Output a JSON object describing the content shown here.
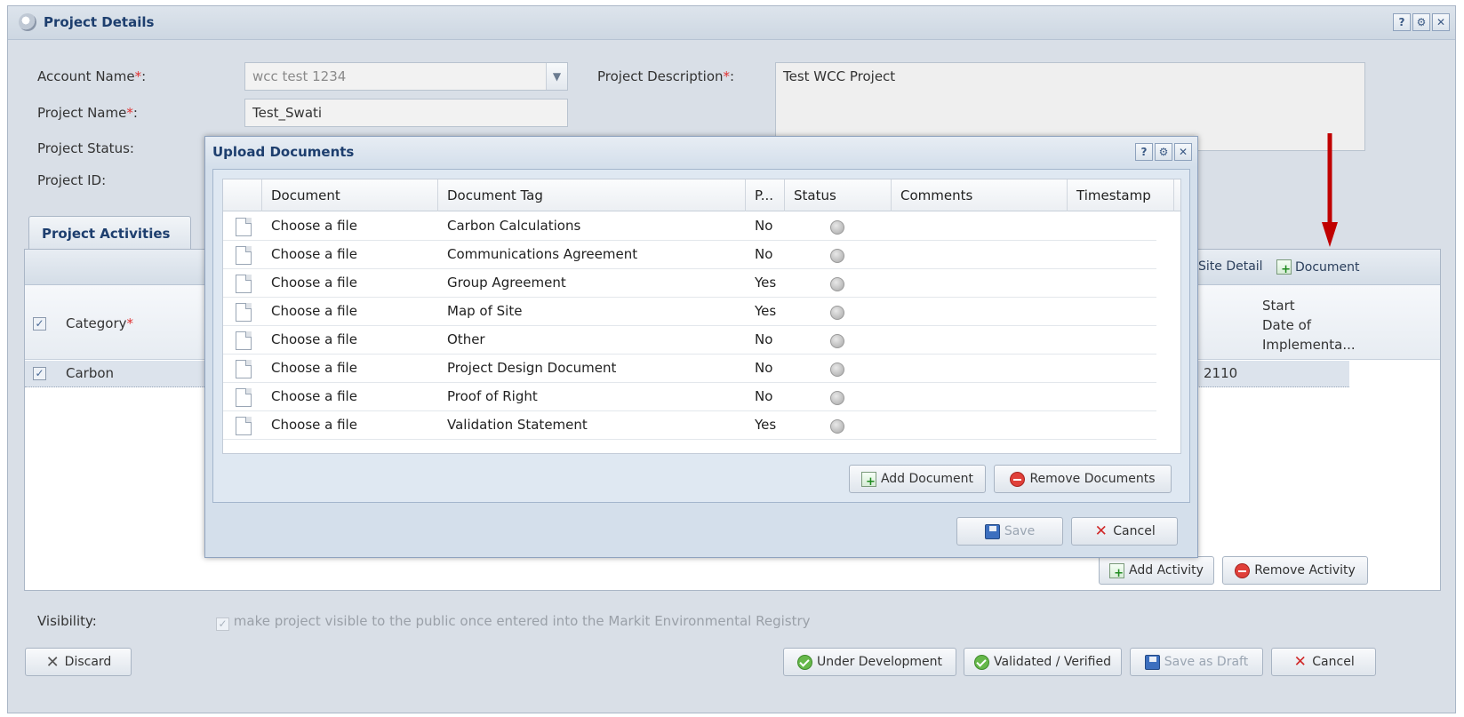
{
  "window": {
    "title": "Project Details",
    "tools": [
      "?",
      "⚙",
      "✕"
    ]
  },
  "form": {
    "account_name_label": "Account Name",
    "account_name_value": "wcc test 1234",
    "project_name_label": "Project Name",
    "project_name_value": "Test_Swati",
    "project_status_label": "Project Status:",
    "project_id_label": "Project ID:",
    "project_description_label": "Project Description",
    "project_description_value": "Test WCC Project",
    "required_mark": "*",
    "colon": ":"
  },
  "tabs": {
    "project_activities": "Project Activities"
  },
  "activities": {
    "toolbar": {
      "site_detail": "Site Detail",
      "document": "Document"
    },
    "columns": {
      "category": "Category",
      "start_date": [
        "Start",
        "Date of",
        "Implementa..."
      ]
    },
    "rows": [
      {
        "category": "Carbon",
        "value_fragment": "2110"
      }
    ],
    "buttons": {
      "add_activity": "Add Activity",
      "remove_activity": "Remove Activity"
    }
  },
  "modal": {
    "title": "Upload Documents",
    "tools": [
      "?",
      "⚙",
      "✕"
    ],
    "columns": [
      "Document",
      "Document Tag",
      "P...",
      "Status",
      "Comments",
      "Timestamp"
    ],
    "rows": [
      {
        "document": "Choose a file",
        "tag": "Carbon Calculations",
        "p": "No"
      },
      {
        "document": "Choose a file",
        "tag": "Communications Agreement",
        "p": "No"
      },
      {
        "document": "Choose a file",
        "tag": "Group Agreement",
        "p": "Yes"
      },
      {
        "document": "Choose a file",
        "tag": "Map of Site",
        "p": "Yes"
      },
      {
        "document": "Choose a file",
        "tag": "Other",
        "p": "No"
      },
      {
        "document": "Choose a file",
        "tag": "Project Design Document",
        "p": "No"
      },
      {
        "document": "Choose a file",
        "tag": "Proof of Right",
        "p": "No"
      },
      {
        "document": "Choose a file",
        "tag": "Validation Statement",
        "p": "Yes"
      }
    ],
    "buttons": {
      "add_document": "Add Document",
      "remove_documents": "Remove Documents",
      "save": "Save",
      "cancel": "Cancel"
    }
  },
  "visibility": {
    "label": "Visibility:",
    "text": "make project visible to the public once entered into the Markit Environmental Registry"
  },
  "footer": {
    "discard": "Discard",
    "under_development": "Under Development",
    "validated": "Validated / Verified",
    "save_draft": "Save as Draft",
    "cancel": "Cancel"
  },
  "colors": {
    "accent": "#1d3e6e",
    "annotation_arrow": "#c00000"
  }
}
